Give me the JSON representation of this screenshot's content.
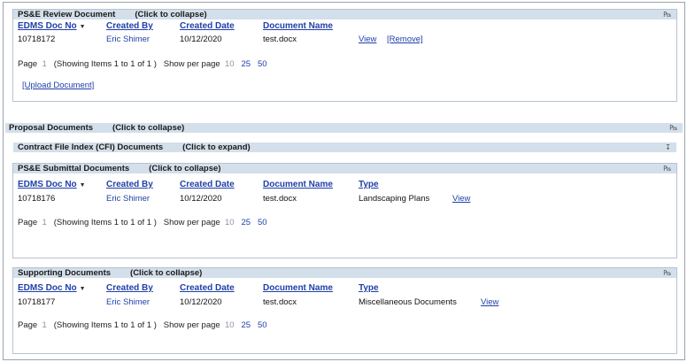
{
  "sections": {
    "pse_review": {
      "title": "PS&E Review Document",
      "action": "(Click to collapse)",
      "headers": {
        "doc_no": "EDMS Doc No",
        "created_by": "Created By",
        "created_date": "Created Date",
        "doc_name": "Document Name"
      },
      "row": {
        "doc_no": "10718172",
        "created_by": "Eric Shimer",
        "created_date": "10/12/2020",
        "doc_name": "test.docx",
        "view": "View",
        "remove": "[Remove]"
      },
      "pager": {
        "page_label": "Page",
        "page_num": "1",
        "showing": "(Showing Items 1 to 1 of 1 )",
        "per_page_label": "Show per page",
        "opt10": "10",
        "opt25": "25",
        "opt50": "50"
      },
      "upload": "[Upload Document]"
    },
    "proposal": {
      "title": "Proposal Documents",
      "action": "(Click to collapse)"
    },
    "cfi": {
      "title": "Contract File Index (CFI) Documents",
      "action": "(Click to expand)"
    },
    "pse_submittal": {
      "title": "PS&E Submittal Documents",
      "action": "(Click to collapse)",
      "headers": {
        "doc_no": "EDMS Doc No",
        "created_by": "Created By",
        "created_date": "Created Date",
        "doc_name": "Document Name",
        "type": "Type"
      },
      "row": {
        "doc_no": "10718176",
        "created_by": "Eric Shimer",
        "created_date": "10/12/2020",
        "doc_name": "test.docx",
        "type": "Landscaping Plans",
        "view": "View"
      },
      "pager": {
        "page_label": "Page",
        "page_num": "1",
        "showing": "(Showing Items 1 to 1 of 1 )",
        "per_page_label": "Show per page",
        "opt10": "10",
        "opt25": "25",
        "opt50": "50"
      }
    },
    "supporting": {
      "title": "Supporting Documents",
      "action": "(Click to collapse)",
      "headers": {
        "doc_no": "EDMS Doc No",
        "created_by": "Created By",
        "created_date": "Created Date",
        "doc_name": "Document Name",
        "type": "Type"
      },
      "row": {
        "doc_no": "10718177",
        "created_by": "Eric Shimer",
        "created_date": "10/12/2020",
        "doc_name": "test.docx",
        "type": "Miscellaneous Documents",
        "view": "View"
      },
      "pager": {
        "page_label": "Page",
        "page_num": "1",
        "showing": "(Showing Items 1 to 1 of 1 )",
        "per_page_label": "Show per page",
        "opt10": "10",
        "opt25": "25",
        "opt50": "50"
      }
    }
  },
  "icons": {
    "collapse": "pin-icon",
    "expand": "expand-icon",
    "sort": "sort-desc-icon"
  },
  "colors": {
    "header_bg": "#d3dfea",
    "link": "#1f3fa8",
    "border": "#b7c3cf"
  }
}
